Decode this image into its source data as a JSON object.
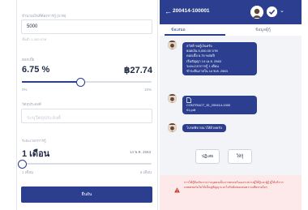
{
  "loan_form": {
    "amount_label": "จำนวนเงินที่ต้องการกู้ (บาท)",
    "amount_value": "5000",
    "amount_hint": "ขั้นต่ำ 1,000 บาท",
    "rate_label": "ดอกเบี้ย",
    "rate_value": "6.75 %",
    "payment_value": "฿27.74",
    "rate_slider": {
      "value_percent": 6.75,
      "min_label": "0%",
      "max_label": "15%",
      "min": 0,
      "max": 15
    },
    "reason_label": "วัตถุประสงค์",
    "reason_placeholder": "ระบุวัตถุประสงค์",
    "term_label": "ระยะเวลาการกู้",
    "term_value": "1 เดือน",
    "term_end_date": "14 พ.ค. 2563",
    "term_slider": {
      "value": 1,
      "min": 1,
      "max": 6,
      "min_label": "1 เดือน",
      "max_label": "6 เดือน"
    },
    "submit_label": "ยืนยัน"
  },
  "chat": {
    "contract_id": "200414-100001",
    "tabs": [
      "ข้อเสนอ",
      "ข้อมูลผู้กู้"
    ],
    "active_tab": 0,
    "messages": [
      {
        "lines": [
          "สวัสดี ขอกู้เงินครับ",
          "ยอดเงิน 5,000.00 บาท",
          "ดอกเบี้ย 6.75 %ต่อปี",
          "เริ่มสัญญา 14 เม.ย. 2563",
          "ระยะเวลาการกู้ 1 เดือน",
          "ชำระคืนภายใน 14 พ.ค. 2563"
        ]
      },
      {
        "file_icon": "document-icon",
        "lines": [
          "CONTRACT_ID_200414-1000",
          "01.pdf"
        ]
      },
      {
        "lines": [
          "โปรดพิจารณาให้ด้วยครับ"
        ]
      }
    ],
    "reject_label": "ปฏิเสธ",
    "accept_label": "ให้กู้"
  },
  "warning": {
    "icon": "warning-icon",
    "text": "การให้กู้ยืมเงินระหว่างบุคคลเป็นการตกลงกันเองระหว่างผู้ให้กู้และผู้กู้ ผู้ให้บริการแพลตฟอร์มไม่ได้เป็นคู่สัญญาและไม่รับผิดชอบต่อความเสียหายใดๆ"
  },
  "colors": {
    "primary": "#2c3e8f",
    "warning_bg": "#fde9ea",
    "warning_text": "#c0392b"
  }
}
